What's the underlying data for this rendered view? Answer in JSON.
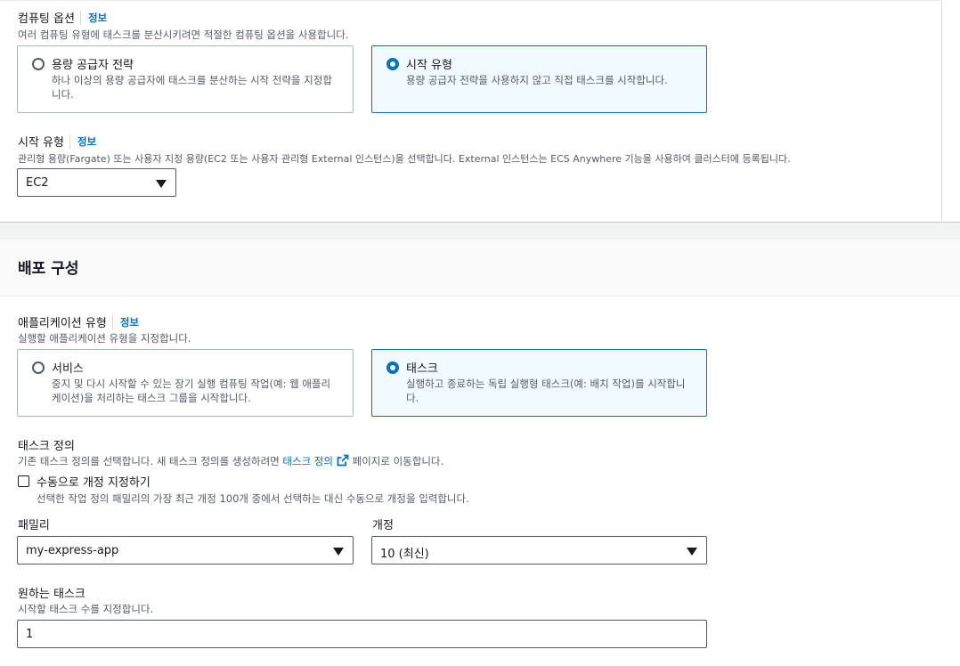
{
  "compute": {
    "label": "컴퓨팅 옵션",
    "info": "정보",
    "description": "여러 컴퓨팅 유형에 태스크를 분산시키려면 적절한 컴퓨팅 옵션을 사용합니다.",
    "options": [
      {
        "title": "용량 공급자 전략",
        "description": "하나 이상의 용량 공급자에 태스크를 분산하는 시작 전략을 지정합니다.",
        "selected": false
      },
      {
        "title": "시작 유형",
        "description": "용량 공급자 전략을 사용하지 않고 직접 태스크를 시작합니다.",
        "selected": true
      }
    ]
  },
  "launch_type": {
    "label": "시작 유형",
    "info": "정보",
    "description": "관리형 용량(Fargate) 또는 사용자 지정 용량(EC2 또는 사용자 관리형 External 인스턴스)을 선택합니다. External 인스턴스는 ECS Anywhere 기능을 사용하여 클러스터에 등록됩니다.",
    "value": "EC2"
  },
  "deployment": {
    "title": "배포 구성",
    "app_type": {
      "label": "애플리케이션 유형",
      "info": "정보",
      "description": "실행할 애플리케이션 유형을 지정합니다.",
      "options": [
        {
          "title": "서비스",
          "description": "중지 및 다시 시작할 수 있는 장기 실행 컴퓨팅 작업(예: 웹 애플리케이션)을 처리하는 태스크 그룹을 시작합니다.",
          "selected": false
        },
        {
          "title": "태스크",
          "description": "실행하고 종료하는 독립 실행형 태스크(예: 배치 작업)를 시작합니다.",
          "selected": true
        }
      ]
    },
    "task_definition": {
      "label": "태스크 정의",
      "description_prefix": "기존 태스크 정의를 선택합니다. 새 태스크 정의를 생성하려면 ",
      "link_text": "태스크 정의",
      "description_suffix": " 페이지로 이동합니다.",
      "manual_checkbox_label": "수동으로 개정 지정하기",
      "manual_checkbox_checked": false,
      "manual_checkbox_description": "선택한 작업 정의 패밀리의 가장 최근 개정 100개 중에서 선택하는 대신 수동으로 개정을 입력합니다."
    },
    "family": {
      "label": "패밀리",
      "value": "my-express-app"
    },
    "revision": {
      "label": "개정",
      "value": "10 (최신)"
    },
    "desired_tasks": {
      "label": "원하는 태스크",
      "description": "시작할 태스크 수를 지정합니다.",
      "value": "1"
    }
  },
  "colors": {
    "accent": "#0073bb",
    "selected_tile_bg": "#f1faff",
    "text": "#16191f",
    "muted": "#545b64"
  }
}
